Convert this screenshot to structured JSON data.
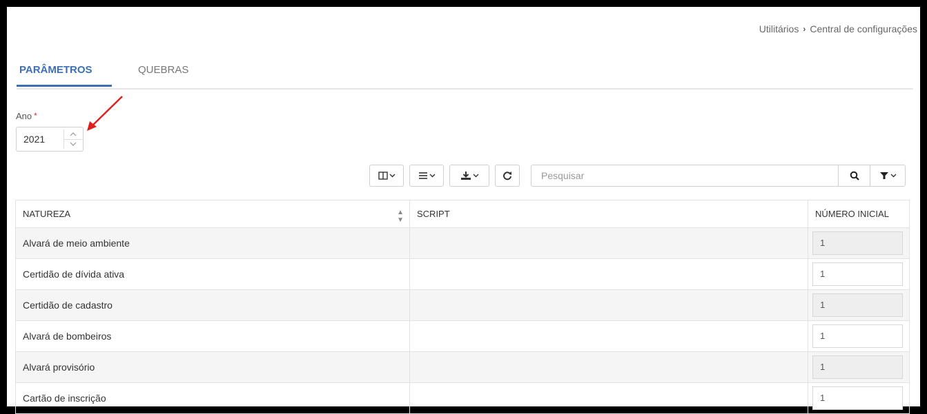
{
  "breadcrumb": {
    "parent": "Utilitários",
    "current": "Central de configurações"
  },
  "tabs": [
    {
      "label": "PARÂMETROS",
      "active": true
    },
    {
      "label": "QUEBRAS",
      "active": false
    }
  ],
  "ano": {
    "label": "Ano",
    "required_mark": "*",
    "value": "2021"
  },
  "toolbar": {
    "icons": [
      "columns-icon",
      "list-icon",
      "download-icon",
      "refresh-icon"
    ],
    "search_placeholder": "Pesquisar"
  },
  "table": {
    "headers": {
      "natureza": "NATUREZA",
      "script": "SCRIPT",
      "numero_inicial": "NÚMERO INICIAL"
    },
    "rows": [
      {
        "natureza": "Alvará de meio ambiente",
        "script": "",
        "numero_inicial": "1",
        "editable": false
      },
      {
        "natureza": "Certidão de dívida ativa",
        "script": "",
        "numero_inicial": "1",
        "editable": true
      },
      {
        "natureza": "Certidão de cadastro",
        "script": "",
        "numero_inicial": "1",
        "editable": false
      },
      {
        "natureza": "Alvará de bombeiros",
        "script": "",
        "numero_inicial": "1",
        "editable": true
      },
      {
        "natureza": "Alvará provisório",
        "script": "",
        "numero_inicial": "1",
        "editable": false
      },
      {
        "natureza": "Cartão de inscrição",
        "script": "",
        "numero_inicial": "1",
        "editable": true
      }
    ]
  },
  "colors": {
    "accent": "#3d6fb5",
    "annotation": "#e02020"
  }
}
